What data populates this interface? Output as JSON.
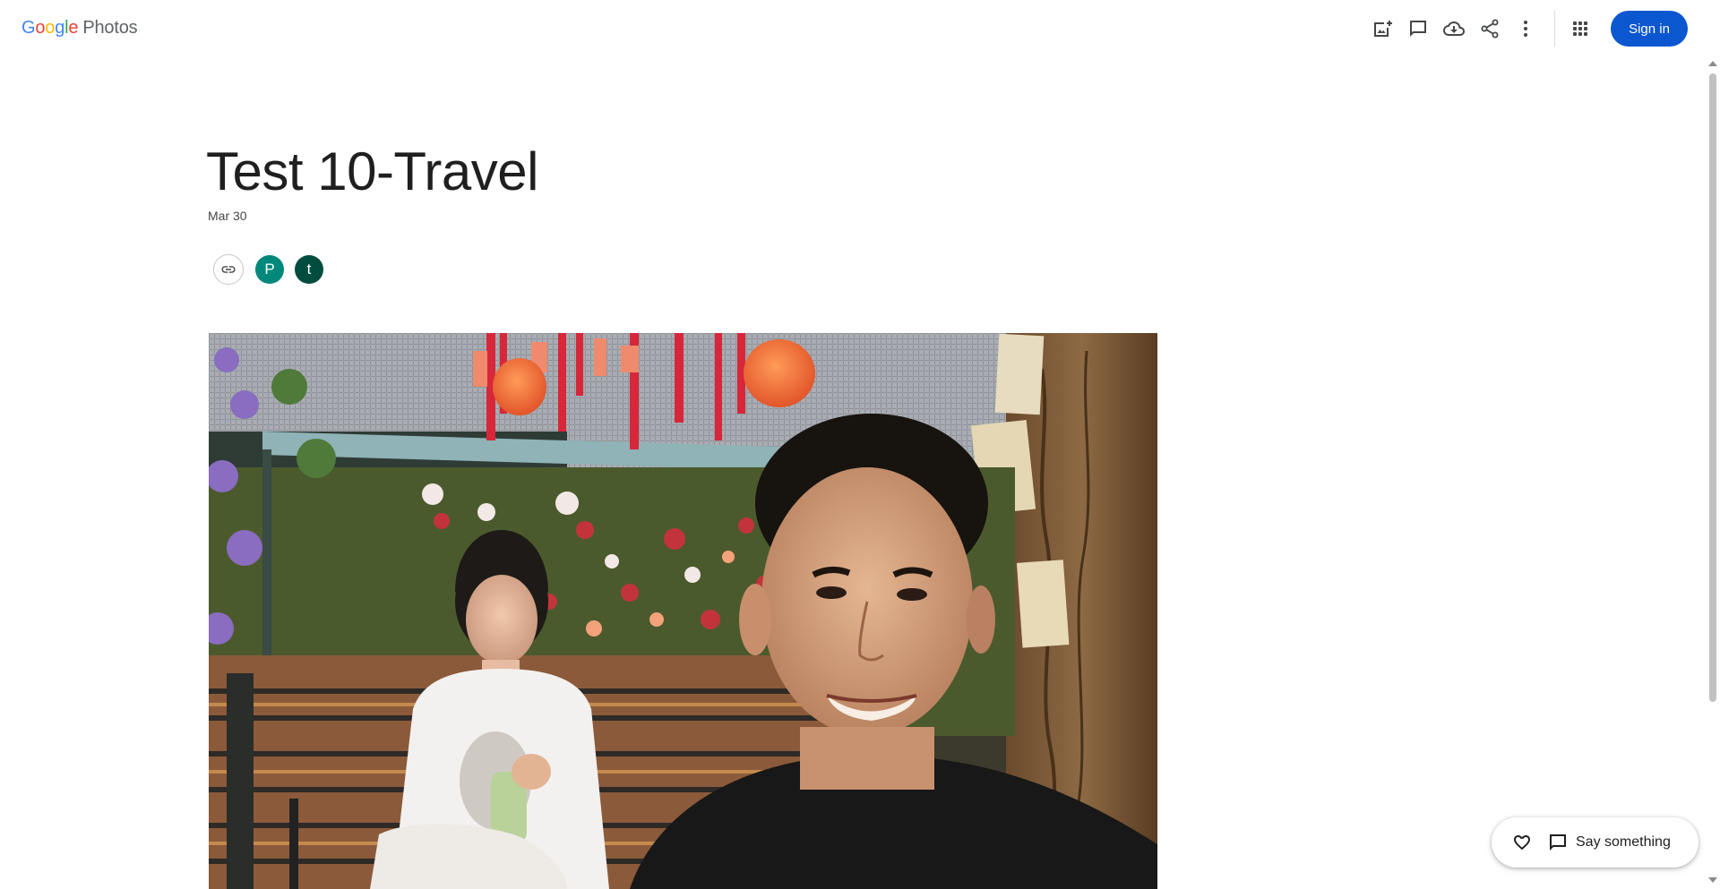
{
  "header": {
    "logo": {
      "google_letters": [
        {
          "ch": "G",
          "color": "#4285f4"
        },
        {
          "ch": "o",
          "color": "#ea4335"
        },
        {
          "ch": "o",
          "color": "#fbbc04"
        },
        {
          "ch": "g",
          "color": "#4285f4"
        },
        {
          "ch": "l",
          "color": "#34a853"
        },
        {
          "ch": "e",
          "color": "#ea4335"
        }
      ],
      "product": "Photos"
    },
    "actions": [
      {
        "name": "add-photos-icon",
        "label": "Add photos"
      },
      {
        "name": "comment-icon",
        "label": "Comments"
      },
      {
        "name": "download-icon",
        "label": "Download all"
      },
      {
        "name": "share-icon",
        "label": "Share"
      },
      {
        "name": "more-options-icon",
        "label": "More options"
      },
      {
        "name": "apps-grid-icon",
        "label": "Google apps"
      }
    ],
    "sign_in_label": "Sign in",
    "accent_color": "#0b57d0"
  },
  "album": {
    "title": "Test 10-Travel",
    "date": "Mar 30"
  },
  "sharing": {
    "link_icon": "link-icon",
    "avatars": [
      {
        "initial": "P",
        "color": "#00897b"
      },
      {
        "initial": "t",
        "color": "#004d40"
      }
    ]
  },
  "footer_actions": {
    "like_icon": "heart-icon",
    "comment_icon": "comment-icon",
    "say_something_label": "Say something"
  }
}
